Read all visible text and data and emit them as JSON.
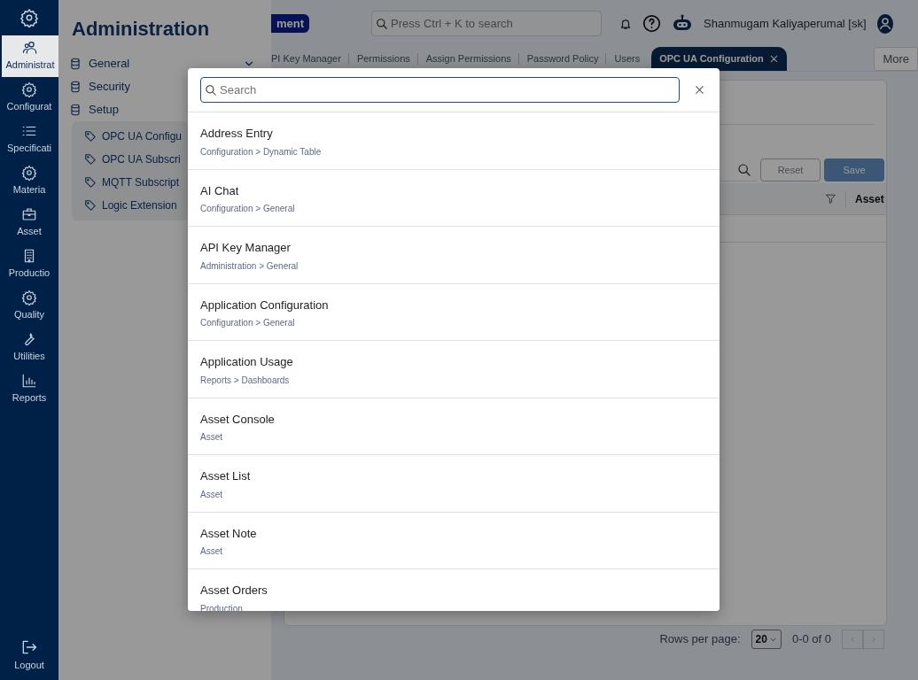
{
  "rail": {
    "items": [
      {
        "label": "Administrat",
        "selected": true
      },
      {
        "label": "Configurat",
        "selected": false
      },
      {
        "label": "Specificati",
        "selected": false
      },
      {
        "label": "Materia",
        "selected": false
      },
      {
        "label": "Asset",
        "selected": false
      },
      {
        "label": "Productio",
        "selected": false
      },
      {
        "label": "Quality",
        "selected": false
      },
      {
        "label": "Utilities",
        "selected": false
      },
      {
        "label": "Reports",
        "selected": false
      }
    ],
    "logout": "Logout"
  },
  "panel": {
    "title": "Administration",
    "groups": [
      {
        "label": "General",
        "kind": "dropdown"
      },
      {
        "label": "Security",
        "kind": "link"
      },
      {
        "label": "Setup",
        "kind": "link",
        "children": [
          {
            "label": "OPC UA Configu"
          },
          {
            "label": "OPC UA Subscri"
          },
          {
            "label": "MQTT Subscript"
          },
          {
            "label": "Logic Extension"
          }
        ]
      }
    ]
  },
  "header": {
    "badge": "ment",
    "search_placeholder": "Press Ctrl + K to search",
    "user": "Shanmugam Kaliyaperumal [sk]"
  },
  "tabs": [
    {
      "label": "PI Key Manager",
      "selected": false
    },
    {
      "label": "Permissions",
      "selected": false
    },
    {
      "label": "Assign Permissions",
      "selected": false
    },
    {
      "label": "Password Policy",
      "selected": false
    },
    {
      "label": "Users",
      "selected": false
    },
    {
      "label": "OPC UA Configuration",
      "selected": true
    }
  ],
  "more": "More",
  "content": {
    "reset": "Reset",
    "save": "Save",
    "column": "Asset",
    "rows_per_page_label": "Rows per page:",
    "rows_per_page": "20",
    "range": "0-0 of 0"
  },
  "dialog": {
    "search_placeholder": "Search",
    "results": [
      {
        "title": "Address Entry",
        "path": "Configuration > Dynamic Table"
      },
      {
        "title": "AI Chat",
        "path": "Configuration > General"
      },
      {
        "title": "API Key Manager",
        "path": "Administration > General"
      },
      {
        "title": "Application Configuration",
        "path": "Configuration > General"
      },
      {
        "title": "Application Usage",
        "path": "Reports > Dashboards"
      },
      {
        "title": "Asset Console",
        "path": "Asset"
      },
      {
        "title": "Asset List",
        "path": "Asset"
      },
      {
        "title": "Asset Note",
        "path": "Asset"
      },
      {
        "title": "Asset Orders",
        "path": "Production"
      }
    ]
  }
}
